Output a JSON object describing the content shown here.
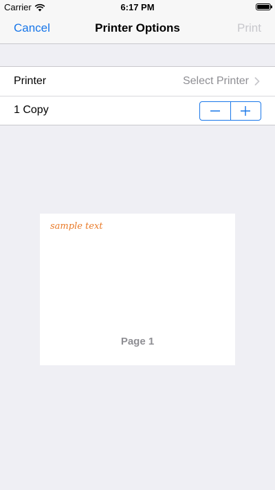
{
  "status": {
    "carrier": "Carrier",
    "time": "6:17 PM"
  },
  "nav": {
    "cancel": "Cancel",
    "title": "Printer Options",
    "print": "Print"
  },
  "options": {
    "printer_label": "Printer",
    "printer_value": "Select Printer",
    "copies_label": "1 Copy",
    "decrement_symbol": "−",
    "increment_symbol": "+"
  },
  "preview": {
    "sample_text": "sample text",
    "page_label": "Page 1"
  },
  "colors": {
    "accent": "#1776e9",
    "disabled": "#c7c7cc",
    "secondary_text": "#8e8e93",
    "background": "#efeff4",
    "sample_text": "#e97a28"
  },
  "icons": {
    "wifi": "wifi-icon",
    "battery": "battery-icon",
    "chevron": "chevron-right-icon",
    "minus": "minus-icon",
    "plus": "plus-icon"
  }
}
